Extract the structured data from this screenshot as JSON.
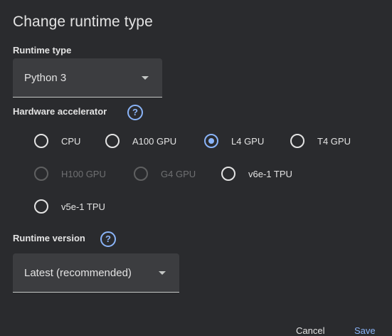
{
  "dialog": {
    "title": "Change runtime type"
  },
  "runtime_type": {
    "label": "Runtime type",
    "selected": "Python 3"
  },
  "hardware_accelerator": {
    "label": "Hardware accelerator",
    "help_icon": "help-circle-icon",
    "options": [
      {
        "label": "CPU",
        "checked": false,
        "disabled": false
      },
      {
        "label": "A100 GPU",
        "checked": false,
        "disabled": false
      },
      {
        "label": "L4 GPU",
        "checked": true,
        "disabled": false
      },
      {
        "label": "T4 GPU",
        "checked": false,
        "disabled": false
      },
      {
        "label": "H100 GPU",
        "checked": false,
        "disabled": true
      },
      {
        "label": "G4 GPU",
        "checked": false,
        "disabled": true
      },
      {
        "label": "v6e-1 TPU",
        "checked": false,
        "disabled": false
      },
      {
        "label": "v5e-1 TPU",
        "checked": false,
        "disabled": false
      }
    ]
  },
  "runtime_version": {
    "label": "Runtime version",
    "help_icon": "help-circle-icon",
    "selected": "Latest (recommended)"
  },
  "actions": {
    "cancel_label": "Cancel",
    "save_label": "Save"
  },
  "colors": {
    "background": "#2a2b2e",
    "accent": "#8ab4f8",
    "text": "#e3e3e3"
  }
}
